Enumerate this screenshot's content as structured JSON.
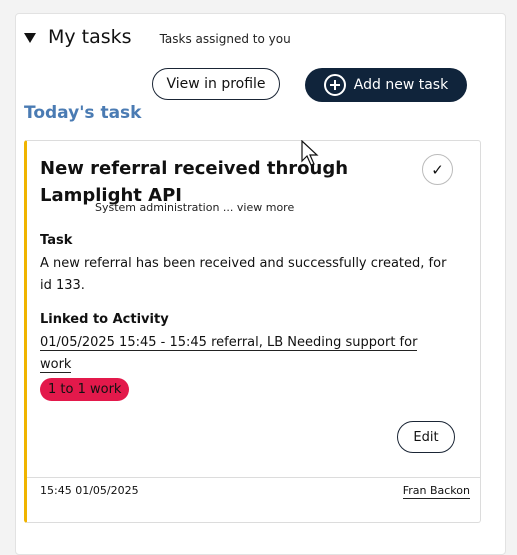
{
  "header": {
    "title": "My tasks",
    "subtitle": "Tasks assigned to you",
    "collapse_icon": "caret-down-icon"
  },
  "actions": {
    "view_profile_label": "View in profile",
    "add_task_label": "Add new task",
    "add_icon": "plus-circle-icon"
  },
  "section": {
    "title": "Today's task"
  },
  "task": {
    "title": "New referral received through Lamplight API",
    "meta": "System administration ...",
    "view_more": "view more",
    "complete_icon": "checkmark-icon",
    "task_label": "Task",
    "task_text": "A new referral has been received and successfully created, for id 133.",
    "linked_label": "Linked to Activity",
    "linked_text": "01/05/2025 15:45 - 15:45 referral, LB Needing support for work",
    "badge": "1 to 1 work",
    "badge_color": "#e3194b",
    "edit_label": "Edit",
    "footer_date": "15:45 01/05/2025",
    "footer_user": "Fran Backon",
    "accent_color": "#f0b400"
  }
}
